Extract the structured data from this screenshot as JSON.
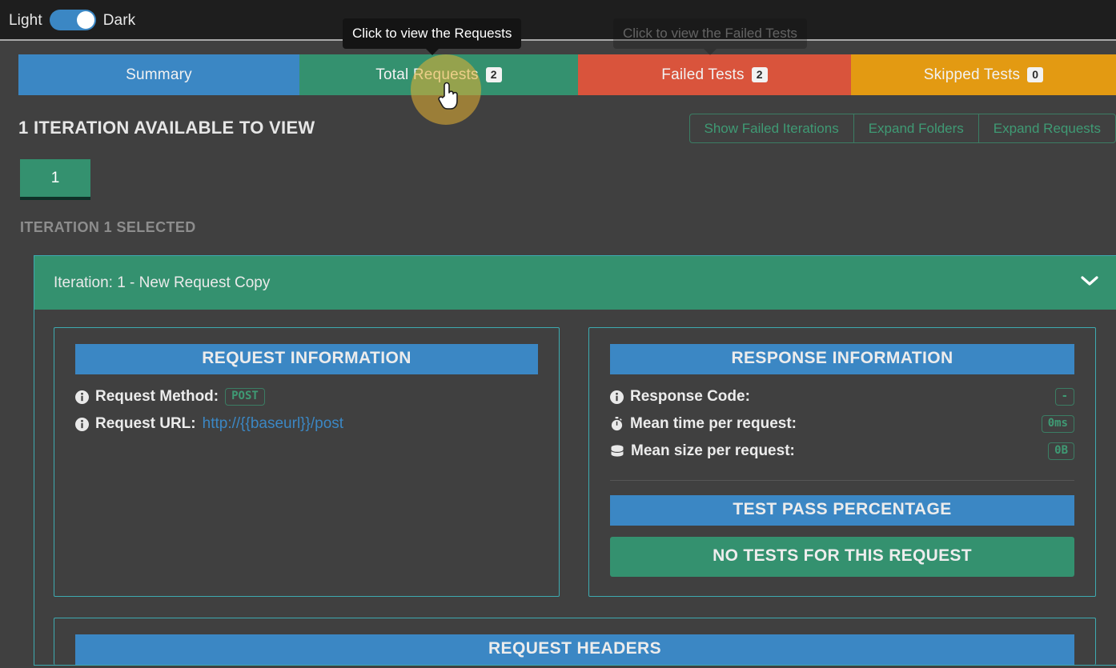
{
  "theme_toggle": {
    "left_label": "Light",
    "right_label": "Dark",
    "state": "Dark"
  },
  "tooltips": {
    "requests": "Click to view the Requests",
    "failed": "Click to view the Failed Tests"
  },
  "tabs": [
    {
      "label": "Summary",
      "count": "",
      "color": "#3b87c4",
      "name": "tab-summary"
    },
    {
      "label": "Total Requests",
      "count": "2",
      "color": "#34916f",
      "name": "tab-total-requests"
    },
    {
      "label": "Failed Tests",
      "count": "2",
      "color": "#d9543c",
      "name": "tab-failed-tests"
    },
    {
      "label": "Skipped Tests",
      "count": "0",
      "color": "#e39a12",
      "name": "tab-skipped-tests"
    }
  ],
  "iterations": {
    "heading": "1 ITERATION AVAILABLE TO VIEW",
    "buttons": [
      {
        "label": "Show Failed Iterations"
      },
      {
        "label": "Expand Folders"
      },
      {
        "label": "Expand Requests"
      }
    ],
    "chips": [
      {
        "label": "1"
      }
    ],
    "selected_text": "ITERATION 1 SELECTED"
  },
  "panel": {
    "header": "Iteration: 1 - New Request Copy",
    "chevron": "chevron-down-icon"
  },
  "request_information": {
    "title": "REQUEST INFORMATION",
    "method_label": "Request Method:",
    "method_value": "POST",
    "url_label": "Request URL:",
    "url_value": "http://{{baseurl}}/post"
  },
  "response_information": {
    "title": "RESPONSE INFORMATION",
    "rows": [
      {
        "icon": "info-circle-icon",
        "label": "Response Code:",
        "value": "-"
      },
      {
        "icon": "stopwatch-icon",
        "label": "Mean time per request:",
        "value": "0ms"
      },
      {
        "icon": "database-icon",
        "label": "Mean size per request:",
        "value": "0B"
      }
    ]
  },
  "test_pass": {
    "title": "TEST PASS PERCENTAGE",
    "banner": "NO TESTS FOR THIS REQUEST"
  },
  "request_headers": {
    "title": "REQUEST HEADERS"
  },
  "colors": {
    "page_bg": "#404040",
    "topbar_bg": "#1e1e1e",
    "blue": "#3b87c4",
    "green": "#34916f",
    "red": "#d9543c",
    "amber": "#e39a12",
    "card_border": "#3daab0",
    "pill_green": "#3f9a74",
    "highlight": "#e6b032"
  }
}
